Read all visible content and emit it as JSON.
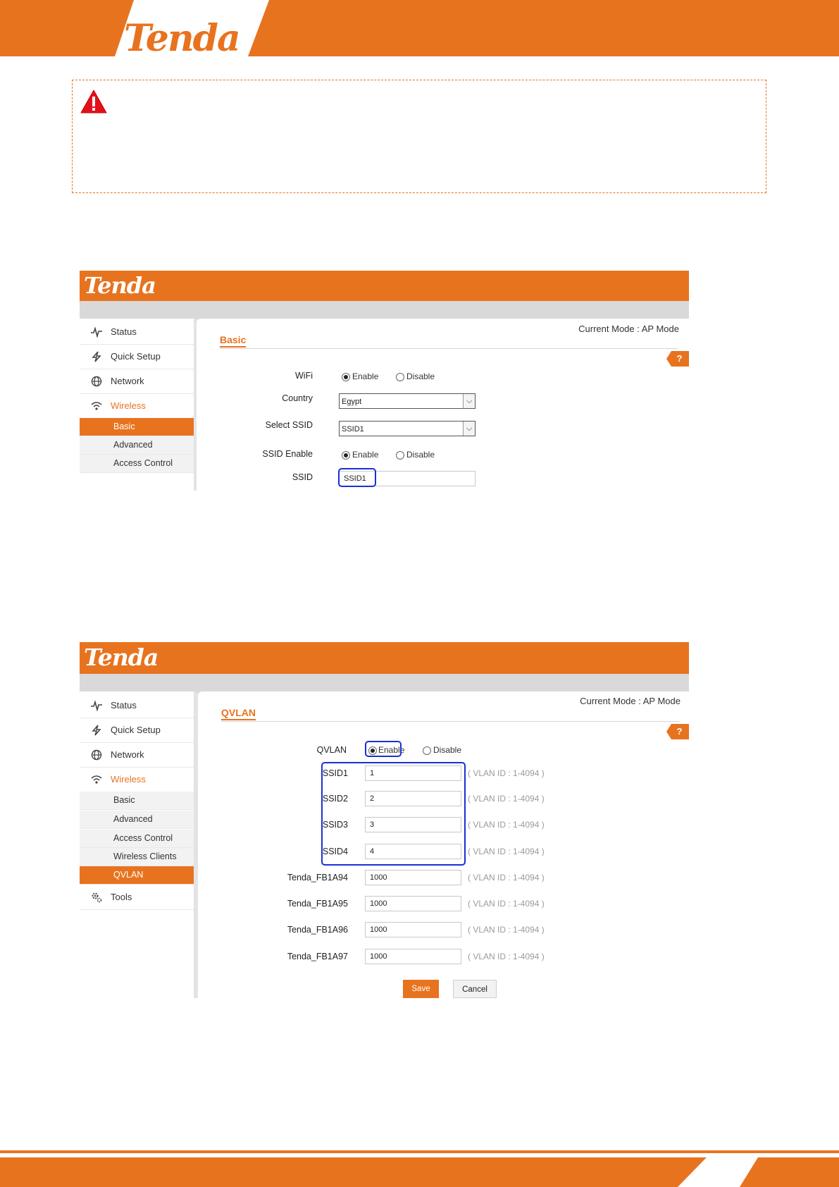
{
  "brand": {
    "logo_text": "Tenda",
    "accent": "#e8731f"
  },
  "warning": {
    "icon": "warning-triangle-icon",
    "text": ""
  },
  "screenshot1": {
    "logo": "Tenda",
    "mode": "Current Mode : AP Mode",
    "section_title": "Basic",
    "help": "?",
    "sidebar": {
      "items": [
        {
          "label": "Status",
          "icon": "pulse-icon"
        },
        {
          "label": "Quick Setup",
          "icon": "lightning-icon"
        },
        {
          "label": "Network",
          "icon": "globe-icon"
        },
        {
          "label": "Wireless",
          "icon": "wifi-icon"
        }
      ],
      "subitems": [
        "Basic",
        "Advanced",
        "Access Control"
      ]
    },
    "form": {
      "wifi_label": "WiFi",
      "enable": "Enable",
      "disable": "Disable",
      "country_label": "Country",
      "country_value": "Egypt",
      "select_ssid_label": "Select SSID",
      "select_ssid_value": "SSID1",
      "ssid_enable_label": "SSID Enable",
      "ssid_label": "SSID",
      "ssid_value": "SSID1"
    }
  },
  "screenshot2": {
    "logo": "Tenda",
    "mode": "Current Mode : AP Mode",
    "section_title": "QVLAN",
    "help": "?",
    "sidebar": {
      "items": [
        {
          "label": "Status",
          "icon": "pulse-icon"
        },
        {
          "label": "Quick Setup",
          "icon": "lightning-icon"
        },
        {
          "label": "Network",
          "icon": "globe-icon"
        },
        {
          "label": "Wireless",
          "icon": "wifi-icon"
        }
      ],
      "subitems": [
        "Basic",
        "Advanced",
        "Access Control",
        "Wireless Clients",
        "QVLAN"
      ],
      "tools": {
        "label": "Tools",
        "icon": "gears-icon"
      }
    },
    "qvlan_label": "QVLAN",
    "enable": "Enable",
    "disable": "Disable",
    "vlan_hint": "( VLAN ID : 1-4094 )",
    "rows": [
      {
        "name": "SSID1",
        "value": "1"
      },
      {
        "name": "SSID2",
        "value": "2"
      },
      {
        "name": "SSID3",
        "value": "3"
      },
      {
        "name": "SSID4",
        "value": "4"
      },
      {
        "name": "Tenda_FB1A94",
        "value": "1000"
      },
      {
        "name": "Tenda_FB1A95",
        "value": "1000"
      },
      {
        "name": "Tenda_FB1A96",
        "value": "1000"
      },
      {
        "name": "Tenda_FB1A97",
        "value": "1000"
      }
    ],
    "save": "Save",
    "cancel": "Cancel"
  }
}
